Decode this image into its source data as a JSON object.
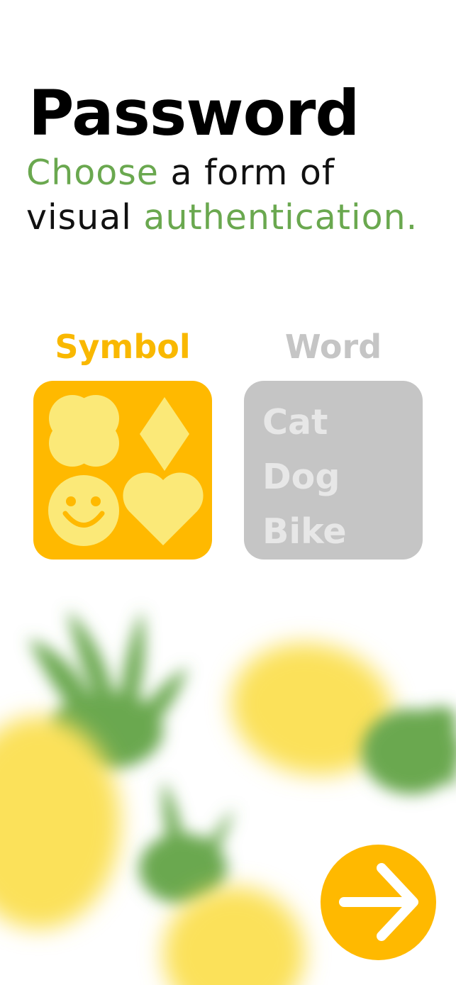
{
  "header": {
    "title": "Password",
    "subtitle": {
      "part1": "Choose",
      "part2": " a form of",
      "part3": "visual ",
      "part4": "authentication."
    }
  },
  "options": {
    "symbol": {
      "label": "Symbol",
      "icons": [
        "clover-icon",
        "diamond-icon",
        "smiley-icon",
        "heart-icon"
      ],
      "selected": true
    },
    "word": {
      "label": "Word",
      "words": [
        "Cat",
        "Dog",
        "Bike"
      ],
      "selected": false
    }
  },
  "next_button": {
    "icon": "arrow-right-icon"
  },
  "colors": {
    "accent_green": "#6aa84f",
    "accent_yellow": "#ffb900",
    "icon_yellow": "#fbe978",
    "inactive_gray": "#c5c5c5"
  }
}
